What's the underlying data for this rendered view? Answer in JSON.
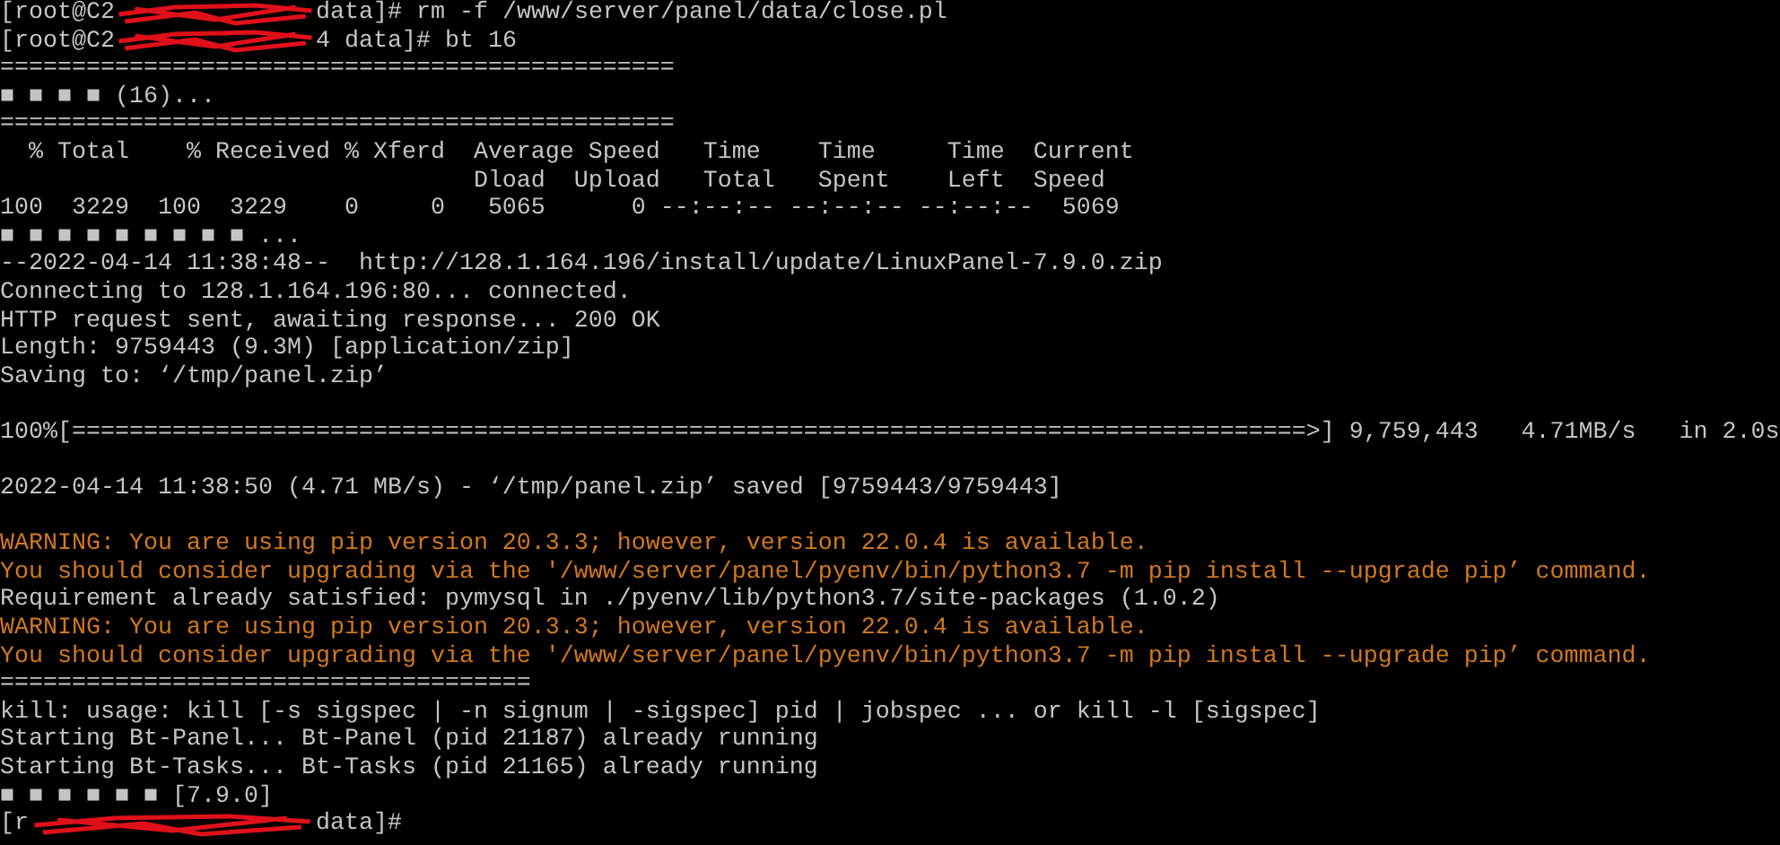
{
  "terminal": {
    "lines": [
      {
        "kind": "prompt",
        "prefix": "[root@C2",
        "command": "data]# rm -f /www/server/panel/data/close.pl"
      },
      {
        "kind": "prompt",
        "prefix": "[root@C2",
        "command": "4 data]# bt 16"
      },
      {
        "kind": "output",
        "text": "==============================================="
      },
      {
        "kind": "output",
        "text": "■ ■ ■ ■ (16)..."
      },
      {
        "kind": "output",
        "text": "==============================================="
      },
      {
        "kind": "output",
        "text": "  % Total    % Received % Xferd  Average Speed   Time    Time     Time  Current"
      },
      {
        "kind": "output",
        "text": "                                 Dload  Upload   Total   Spent    Left  Speed"
      },
      {
        "kind": "output",
        "text": "100  3229  100  3229    0     0   5065      0 --:--:-- --:--:-- --:--:--  5069"
      },
      {
        "kind": "output",
        "text": "■ ■ ■ ■ ■ ■ ■ ■ ■ ..."
      },
      {
        "kind": "output",
        "text": "--2022-04-14 11:38:48--  http://128.1.164.196/install/update/LinuxPanel-7.9.0.zip"
      },
      {
        "kind": "output",
        "text": "Connecting to 128.1.164.196:80... connected."
      },
      {
        "kind": "output",
        "text": "HTTP request sent, awaiting response... 200 OK"
      },
      {
        "kind": "output",
        "text": "Length: 9759443 (9.3M) [application/zip]"
      },
      {
        "kind": "output",
        "text": "Saving to: ‘/tmp/panel.zip’"
      },
      {
        "kind": "blank"
      },
      {
        "kind": "output",
        "text": "100%[======================================================================================>] 9,759,443   4.71MB/s   in 2.0s"
      },
      {
        "kind": "blank"
      },
      {
        "kind": "output",
        "text": "2022-04-14 11:38:50 (4.71 MB/s) - ‘/tmp/panel.zip’ saved [9759443/9759443]"
      },
      {
        "kind": "blank"
      },
      {
        "kind": "warning",
        "text": "WARNING: You are using pip version 20.3.3; however, version 22.0.4 is available."
      },
      {
        "kind": "warning",
        "text": "You should consider upgrading via the '/www/server/panel/pyenv/bin/python3.7 -m pip install --upgrade pip’ command."
      },
      {
        "kind": "output",
        "text": "Requirement already satisfied: pymysql in ./pyenv/lib/python3.7/site-packages (1.0.2)"
      },
      {
        "kind": "warning",
        "text": "WARNING: You are using pip version 20.3.3; however, version 22.0.4 is available."
      },
      {
        "kind": "warning",
        "text": "You should consider upgrading via the '/www/server/panel/pyenv/bin/python3.7 -m pip install --upgrade pip’ command."
      },
      {
        "kind": "output",
        "text": "====================================="
      },
      {
        "kind": "output",
        "text": "kill: usage: kill [-s sigspec | -n signum | -sigspec] pid | jobspec ... or kill -l [sigspec]"
      },
      {
        "kind": "output",
        "text": "Starting Bt-Panel... Bt-Panel (pid 21187) already running"
      },
      {
        "kind": "output",
        "text": "Starting Bt-Tasks... Bt-Tasks (pid 21165) already running"
      },
      {
        "kind": "output",
        "text": "■ ■ ■ ■ ■ ■ [7.9.0]"
      },
      {
        "kind": "prompt",
        "prefix": "[r",
        "command": "data]#"
      }
    ]
  }
}
